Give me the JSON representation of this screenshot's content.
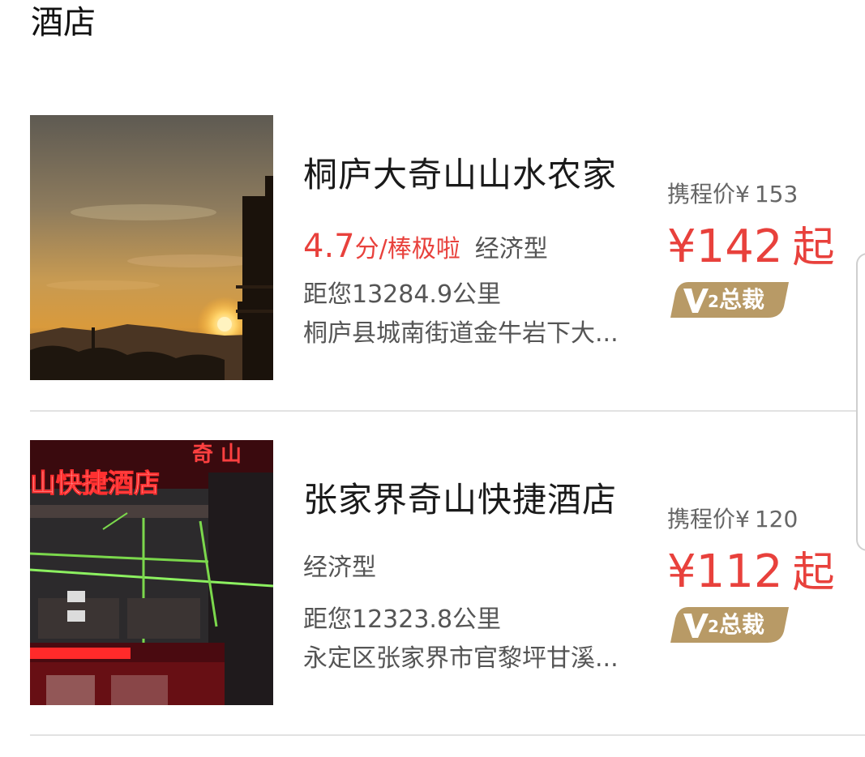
{
  "section": {
    "title": "酒店"
  },
  "hotels": [
    {
      "name": "桐庐大奇山山水农家",
      "score": "4.7",
      "score_unit": "分/",
      "score_word": "棒极啦",
      "type": "经济型",
      "distance": "距您13284.9公里",
      "address": "桐庐县城南街道金牛岩下大...",
      "ctrip_label": "携程价¥",
      "ctrip_amount": "153",
      "price": "¥142",
      "price_suffix": "起",
      "vip_level": "2",
      "vip_label": "总裁",
      "image": "sunset-mountain-photo"
    },
    {
      "name": "张家界奇山快捷酒店",
      "type": "经济型",
      "distance": "距您12323.8公里",
      "address": "永定区张家界市官黎坪甘溪...",
      "ctrip_label": "携程价¥",
      "ctrip_amount": "120",
      "price": "¥112",
      "price_suffix": "起",
      "vip_level": "2",
      "vip_label": "总裁",
      "image": "hotel-night-facade-photo",
      "sign_text": "山快捷酒店",
      "roof_text": "奇 山"
    }
  ],
  "colors": {
    "price_red": "#e8413c",
    "badge_gold": "#b89a66",
    "text_gray": "#555555",
    "divider": "#e2e2e2"
  }
}
